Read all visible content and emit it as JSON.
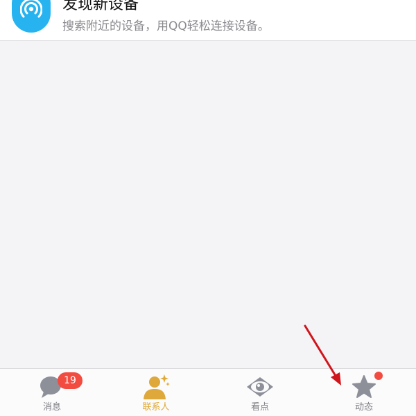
{
  "device_card": {
    "title": "发现新设备",
    "description": "搜索附近的设备，用QQ轻松连接设备。",
    "icon": "device-signal-icon"
  },
  "tab_bar": {
    "tabs": [
      {
        "label": "消息",
        "icon": "chat-bubble-icon",
        "badge": "19",
        "active": false
      },
      {
        "label": "联系人",
        "icon": "contact-person-icon",
        "active": true
      },
      {
        "label": "看点",
        "icon": "eye-icon",
        "active": false
      },
      {
        "label": "动态",
        "icon": "star-icon",
        "has_dot": true,
        "active": false
      }
    ]
  },
  "colors": {
    "accent_blue": "#27b3f0",
    "active_gold": "#e0a836",
    "badge_red": "#f24b40",
    "annotation_arrow": "#d0151c"
  }
}
